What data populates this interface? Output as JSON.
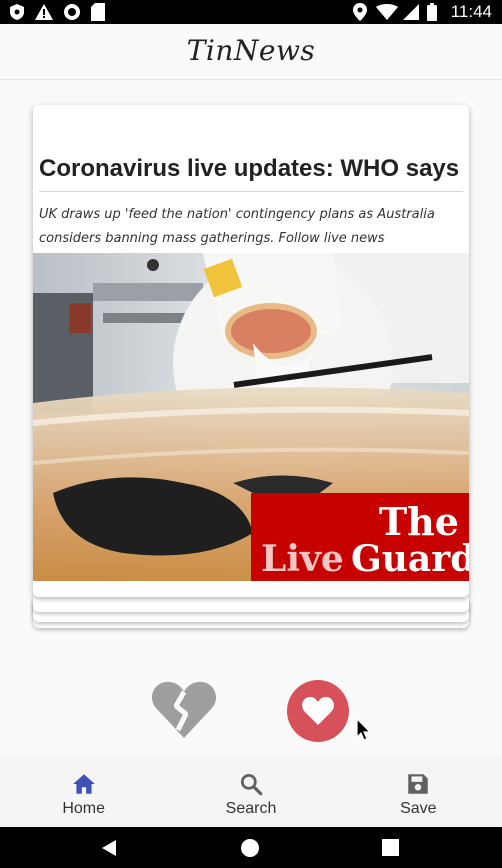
{
  "status_bar": {
    "time": "11:44",
    "left_icons": [
      "shield-icon",
      "warning-icon",
      "circle-icon",
      "sd-card-icon"
    ],
    "right_icons": [
      "location-icon",
      "wifi-icon",
      "signal-icon",
      "battery-icon"
    ]
  },
  "app_bar": {
    "title": "TinNews"
  },
  "card": {
    "title": "Coronavirus live updates: WHO says...",
    "description": "UK draws up 'feed the nation' contingency plans as Australia considers banning mass gatherings. Follow live news",
    "image_overlay": {
      "line1": "The",
      "line2_part1": "Live",
      "line2_part2": "Guard"
    }
  },
  "actions": {
    "dislike_icon": "broken-heart-icon",
    "like_icon": "heart-icon"
  },
  "bottom_nav": {
    "items": [
      {
        "label": "Home",
        "icon": "home-icon",
        "active": true
      },
      {
        "label": "Search",
        "icon": "search-icon",
        "active": false
      },
      {
        "label": "Save",
        "icon": "save-icon",
        "active": false
      }
    ]
  },
  "system_nav": {
    "icons": [
      "back-icon",
      "home-circle-icon",
      "recents-icon"
    ]
  },
  "colors": {
    "accent": "#3f51b5",
    "like": "#d7515a",
    "dislike": "#9e9e9e",
    "guardian_red": "#c70000"
  }
}
